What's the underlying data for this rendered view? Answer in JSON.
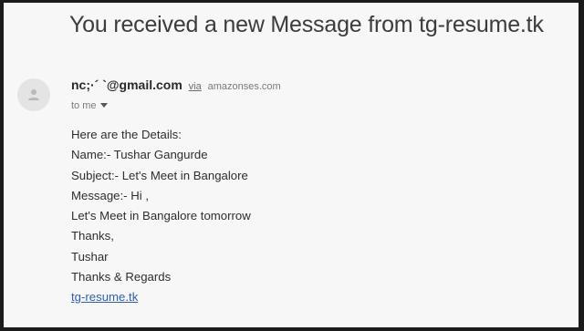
{
  "email": {
    "subject": "You received a new Message from tg-resume.tk",
    "sender": {
      "email": "nc;·´   `@gmail.com",
      "via_label": "via",
      "via_domain": "amazonses.com"
    },
    "recipient_label": "to me",
    "body_lines": [
      "Here are the Details:",
      "Name:- Tushar Gangurde",
      "Subject:- Let's Meet in Bangalore",
      "Message:- Hi ,",
      "Let's Meet in Bangalore tomorrow",
      "Thanks,",
      "Tushar",
      "Thanks & Regards"
    ],
    "link_text": "tg-resume.tk"
  },
  "icons": {
    "avatar": "person-icon",
    "dropdown": "caret-down-icon"
  },
  "colors": {
    "background": "#f7f7f7",
    "frame": "#1b1b1b",
    "link": "#2f5fb3"
  }
}
